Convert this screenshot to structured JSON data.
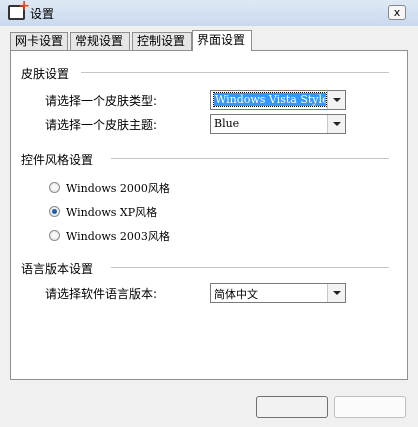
{
  "window": {
    "title": "设置",
    "close_glyph": "x"
  },
  "tabs": [
    {
      "label": "网卡设置",
      "active": false
    },
    {
      "label": "常规设置",
      "active": false
    },
    {
      "label": "控制设置",
      "active": false
    },
    {
      "label": "界面设置",
      "active": true
    }
  ],
  "skin": {
    "section_title": "皮肤设置",
    "type_label": "请选择一个皮肤类型:",
    "type_value": "Windows Vista Style",
    "theme_label": "请选择一个皮肤主题:",
    "theme_value": "Blue"
  },
  "control_style": {
    "section_title": "控件风格设置",
    "options": [
      {
        "label": "Windows 2000风格",
        "checked": false
      },
      {
        "label": "Windows XP风格",
        "checked": true
      },
      {
        "label": "Windows 2003风格",
        "checked": false
      }
    ]
  },
  "language": {
    "section_title": "语言版本设置",
    "label": "请选择软件语言版本:",
    "value": "简体中文"
  },
  "icons": {
    "app": "app-settings-icon",
    "close": "close-icon",
    "dropdown": "chevron-down-icon"
  }
}
